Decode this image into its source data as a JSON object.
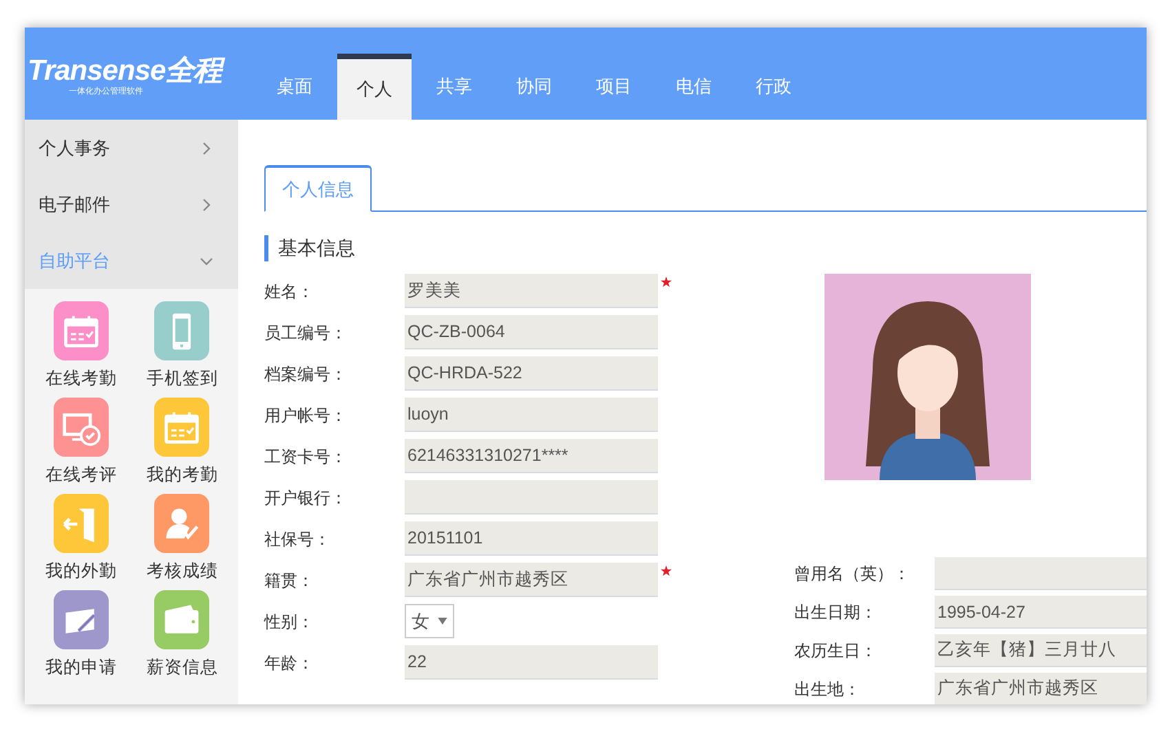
{
  "logo": {
    "name": "Transense全程",
    "tagline": "一体化办公管理软件"
  },
  "nav_tabs": [
    {
      "label": "桌面",
      "selected": false
    },
    {
      "label": "个人",
      "selected": true
    },
    {
      "label": "共享",
      "selected": false
    },
    {
      "label": "协同",
      "selected": false
    },
    {
      "label": "项目",
      "selected": false
    },
    {
      "label": "电信",
      "selected": false
    },
    {
      "label": "行政",
      "selected": false
    }
  ],
  "sidebar": {
    "menu": [
      {
        "label": "个人事务",
        "expanded": false
      },
      {
        "label": "电子邮件",
        "expanded": false
      },
      {
        "label": "自助平台",
        "expanded": true
      }
    ],
    "apps": [
      {
        "label": "在线考勤",
        "kind": "calendar",
        "color": "#fd8fc8"
      },
      {
        "label": "手机签到",
        "kind": "phone",
        "color": "#97cdcb"
      },
      {
        "label": "在线考评",
        "kind": "monitor",
        "color": "#fe9191"
      },
      {
        "label": "我的考勤",
        "kind": "calendar",
        "color": "#fec73a"
      },
      {
        "label": "我的外勤",
        "kind": "door",
        "color": "#fec73a"
      },
      {
        "label": "考核成绩",
        "kind": "person",
        "color": "#fe9864"
      },
      {
        "label": "我的申请",
        "kind": "pen",
        "color": "#9d97cb"
      },
      {
        "label": "薪资信息",
        "kind": "wallet",
        "color": "#97cb64"
      }
    ]
  },
  "content_tabs": [
    {
      "label": "个人信息",
      "selected": true
    }
  ],
  "section_title": "基本信息",
  "left_fields": [
    {
      "label": "姓名：",
      "value": "罗美美",
      "required": true,
      "kind": "text"
    },
    {
      "label": "员工编号：",
      "value": "QC-ZB-0064",
      "required": false,
      "kind": "text"
    },
    {
      "label": "档案编号：",
      "value": "QC-HRDA-522",
      "required": false,
      "kind": "text"
    },
    {
      "label": "用户帐号：",
      "value": "luoyn",
      "required": false,
      "kind": "text"
    },
    {
      "label": "工资卡号：",
      "value": "62146331310271****",
      "required": false,
      "kind": "text"
    },
    {
      "label": "开户银行：",
      "required": false,
      "kind": "text"
    },
    {
      "label": "社保号：",
      "value": "20151101",
      "required": false,
      "kind": "text"
    },
    {
      "label": "籍贯：",
      "value": "广东省广州市越秀区",
      "required": true,
      "kind": "text"
    },
    {
      "label": "性别：",
      "value": "女",
      "required": false,
      "kind": "select"
    },
    {
      "label": "年龄：",
      "value": "22",
      "required": false,
      "kind": "text"
    }
  ],
  "right_fields": [
    {
      "label": "曾用名（英）："
    },
    {
      "label": "出生日期：",
      "value": "1995-04-27"
    },
    {
      "label": "农历生日：",
      "value": "乙亥年【猪】三月廿八"
    },
    {
      "label": "出生地：",
      "value": "广东省广州市越秀区"
    }
  ]
}
